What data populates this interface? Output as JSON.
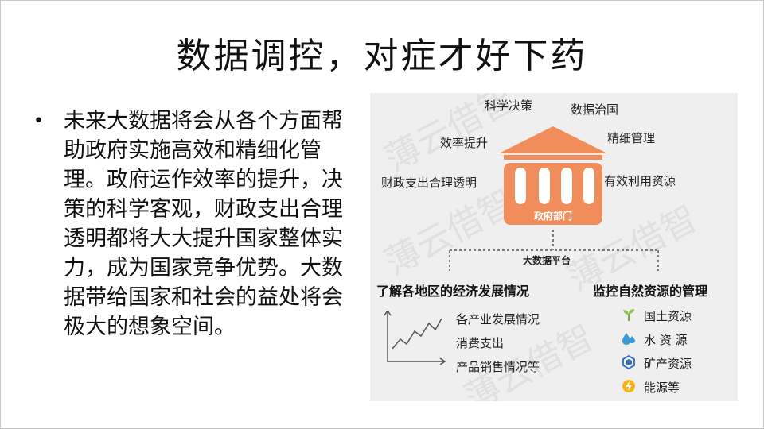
{
  "slide": {
    "title": "数据调控，对症才好下药",
    "bullet_marker": "•",
    "bullet_text": "未来大数据将会从各个方面帮助政府实施高效和精细化管理。政府运作效率的提升，决策的科学客观，财政支出合理透明都将大大提升国家整体实力，成为国家竞争优势。大数据带给国家和社会的益处将会极大的想象空间。"
  },
  "diagram": {
    "watermark": "薄云借智",
    "top_labels": [
      "科学决策",
      "数据治国",
      "效率提升",
      "精细管理",
      "财政支出合理透明",
      "有效利用资源"
    ],
    "government_label": "政府部门",
    "platform_label": "大数据平台",
    "left_heading": "了解各地区的经济发展情况",
    "left_items": [
      "各产业发展情况",
      "消费支出",
      "产品销售情况等"
    ],
    "right_heading": "监控自然资源的管理",
    "right_items": [
      "国土资源",
      "水 资 源",
      "矿产资源",
      "能源等"
    ],
    "colors": {
      "accent": "#f08d5a",
      "line": "#555555",
      "panel": "#efefef"
    },
    "icons": [
      "building-icon",
      "line-chart-icon",
      "sprout-icon",
      "water-drop-icon",
      "mineral-icon",
      "energy-icon"
    ]
  }
}
